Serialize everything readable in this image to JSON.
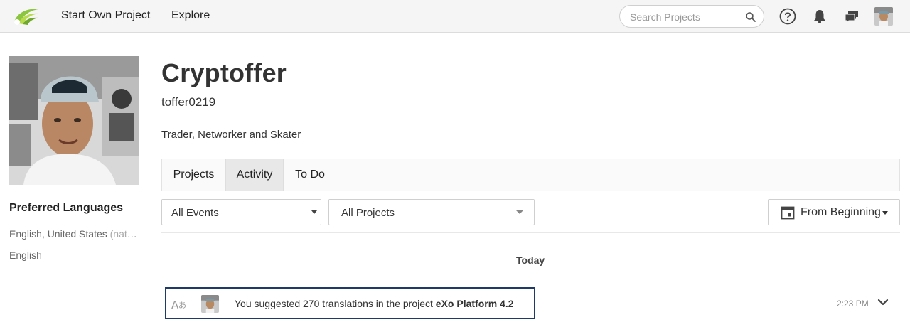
{
  "topbar": {
    "nav": [
      "Start Own Project",
      "Explore"
    ],
    "search_placeholder": "Search Projects",
    "icons": [
      "help-icon",
      "bell-icon",
      "chat-icon"
    ]
  },
  "profile": {
    "name": "Cryptoffer",
    "handle": "toffer0219",
    "bio": "Trader, Networker and Skater"
  },
  "languages": {
    "title": "Preferred Languages",
    "items": [
      {
        "name": "English, United States",
        "suffix": "(native)"
      },
      {
        "name": "English",
        "suffix": ""
      }
    ]
  },
  "tabs": [
    {
      "label": "Projects",
      "active": false
    },
    {
      "label": "Activity",
      "active": true
    },
    {
      "label": "To Do",
      "active": false
    }
  ],
  "filters": {
    "events": "All Events",
    "projects": "All Projects",
    "date": "From Beginning"
  },
  "activity": {
    "day": "Today",
    "items": [
      {
        "text_prefix": "You suggested 270 translations in the project",
        "project": "eXo Platform 4.2",
        "time": "2:23 PM"
      }
    ]
  },
  "colors": {
    "logo_green": "#8cc63f",
    "selection_border": "#1f3a68",
    "topbar_bg": "#f5f5f5"
  }
}
